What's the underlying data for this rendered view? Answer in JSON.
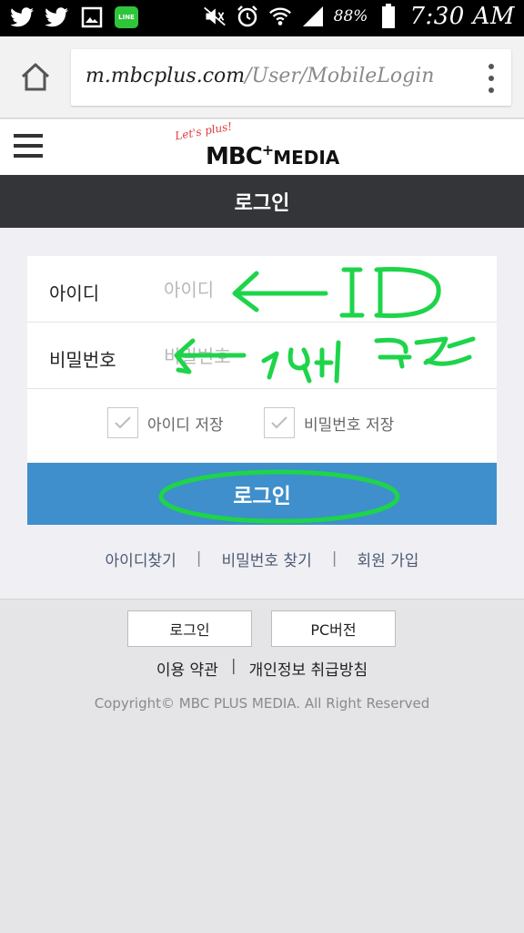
{
  "status_bar": {
    "icons": [
      "twitter-icon",
      "twitter-icon",
      "gallery-icon",
      "line-app-icon",
      "mute-icon",
      "alarm-icon",
      "wifi-icon",
      "signal-icon",
      "battery-icon"
    ],
    "line_label": "LINE",
    "battery": "88%",
    "time": "7:30 AM"
  },
  "browser": {
    "url_host": "m.mbcplus.com",
    "url_path": "/User/MobileLogin",
    "home_icon": "home-icon",
    "menu_icon": "overflow-menu-icon"
  },
  "site_header": {
    "logo_tagline": "Let's plus!",
    "logo_main": "MBC",
    "logo_plus": "+",
    "logo_media": "MEDIA"
  },
  "title": "로그인",
  "form": {
    "id_label": "아이디",
    "id_placeholder": "아이디",
    "pw_label": "비밀번호",
    "pw_placeholder": "비밀번호",
    "save_id_label": "아이디 저장",
    "save_pw_label": "비밀번호 저장",
    "login_button": "로그인"
  },
  "links": {
    "find_id": "아이디찾기",
    "find_pw": "비밀번호 찾기",
    "signup": "회원 가입",
    "separator": "|"
  },
  "footer": {
    "login_button": "로그인",
    "pc_button": "PC버전",
    "terms": "이용 약관",
    "privacy": "개인정보 취급방침",
    "separator": "|",
    "copyright": "Copyright© MBC PLUS MEDIA. All Right Reserved"
  },
  "annotations": {
    "id_note": "ID",
    "pw_note": "19자 리"
  },
  "colors": {
    "accent_blue": "#3e8fcc",
    "title_bar": "#333538",
    "annotation_green": "#1ed44a"
  }
}
